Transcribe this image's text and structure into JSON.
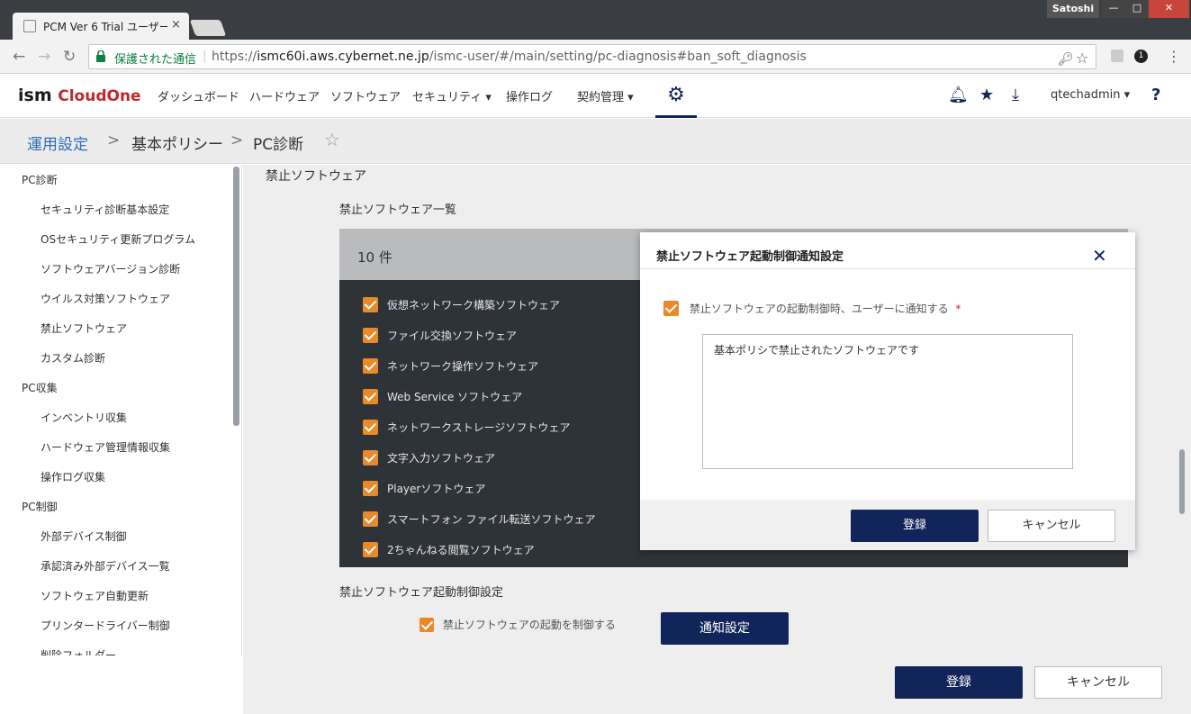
{
  "browser": {
    "tab_title": "PCM Ver 6 Trial ユーザー",
    "tab_close": "×",
    "profile_name": "Satoshi",
    "window_buttons": {
      "minimize": "—",
      "maximize": "□",
      "close": "✕"
    },
    "secure_label": "保護された通信",
    "url_scheme": "https://",
    "url_host": "ismc60i.aws.cybernet.ne.jp",
    "url_path": "/ismc-user/#/main/setting/pc-diagnosis#ban_soft_diagnosis",
    "extension_badge": "1"
  },
  "header": {
    "logo_main": "ism",
    "logo_sub": "CloudOne",
    "menu": [
      {
        "label": "ダッシュボード"
      },
      {
        "label": "ハードウェア"
      },
      {
        "label": "ソフトウェア"
      },
      {
        "label": "セキュリティ ▾"
      },
      {
        "label": "操作ログ"
      },
      {
        "label": "契約管理 ▾"
      }
    ],
    "username": "qtechadmin ▾",
    "help": "?"
  },
  "breadcrumb": {
    "root": "運用設定",
    "sep": ">",
    "middle": "基本ポリシー",
    "current": "PC診断",
    "star": "☆"
  },
  "sidebar": {
    "groups": [
      {
        "label": "PC診断",
        "items": [
          "セキュリティ診断基本設定",
          "OSセキュリティ更新プログラム",
          "ソフトウェアバージョン診断",
          "ウイルス対策ソフトウェア",
          "禁止ソフトウェア",
          "カスタム診断"
        ]
      },
      {
        "label": "PC収集",
        "items": [
          "インベントリ収集",
          "ハードウェア管理情報収集",
          "操作ログ収集"
        ]
      },
      {
        "label": "PC制御",
        "items": [
          "外部デバイス制御",
          "承認済み外部デバイス一覧",
          "ソフトウェア自動更新",
          "プリンタードライバー制御",
          "削除フォルダー"
        ]
      }
    ]
  },
  "main": {
    "section_title": "禁止ソフトウェア",
    "list_title": "禁止ソフトウェア一覧",
    "count": "10 件",
    "items": [
      {
        "label": "仮想ネットワーク構築ソフトウェア",
        "checked": true
      },
      {
        "label": "ファイル交換ソフトウェア",
        "checked": true
      },
      {
        "label": "ネットワーク操作ソフトウェア",
        "checked": true
      },
      {
        "label": "Web Service ソフトウェア",
        "checked": true
      },
      {
        "label": "ネットワークストレージソフトウェア",
        "checked": true
      },
      {
        "label": "文字入力ソフトウェア",
        "checked": true
      },
      {
        "label": "Playerソフトウェア",
        "checked": true
      },
      {
        "label": "スマートフォン ファイル転送ソフトウェア",
        "checked": true
      },
      {
        "label": "2ちゃんねる閲覧ソフトウェア",
        "checked": true
      }
    ],
    "control_title": "禁止ソフトウェア起動制御設定",
    "control_checkbox_label": "禁止ソフトウェアの起動を制御する",
    "notify_button": "通知設定",
    "register_button": "登録",
    "cancel_button": "キャンセル"
  },
  "modal": {
    "title": "禁止ソフトウェア起動制御通知設定",
    "close": "✕",
    "notify_checkbox_label": "禁止ソフトウェアの起動制御時、ユーザーに通知する",
    "required_mark": "*",
    "message": "基本ポリシで禁止されたソフトウェアです",
    "register_button": "登録",
    "cancel_button": "キャンセル"
  },
  "colors": {
    "navy": "#12255a",
    "checkbox_orange": "#e8892a",
    "panel_dark": "#2e3338",
    "link_blue": "#2f6db5"
  }
}
